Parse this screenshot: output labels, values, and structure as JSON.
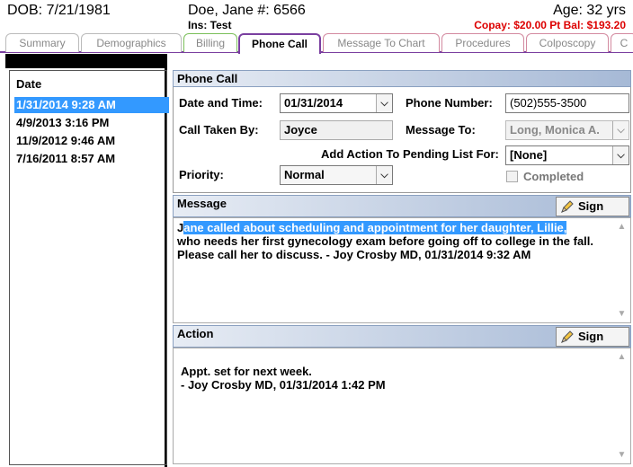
{
  "header": {
    "dob": "DOB: 7/21/1981",
    "patient": "Doe, Jane #: 6566",
    "insurance": "Ins: Test",
    "age": "Age: 32 yrs",
    "copay": "Copay: $20.00 Pt Bal: $193.20"
  },
  "tabs": [
    {
      "label": "Summary",
      "color": "#888888"
    },
    {
      "label": "Demographics",
      "color": "#888888"
    },
    {
      "label": "Billing",
      "color": "#7bbf5a"
    },
    {
      "label": "Phone Call",
      "color": "#7a3fa0"
    },
    {
      "label": "Message To Chart",
      "color": "#d38aa0"
    },
    {
      "label": "Procedures",
      "color": "#d38aa0"
    },
    {
      "label": "Colposcopy",
      "color": "#d38aa0"
    },
    {
      "label": "C",
      "color": "#d38aa0"
    }
  ],
  "left": {
    "header": "Date",
    "items": [
      "1/31/2014 9:28 AM",
      "4/9/2013 3:16 PM",
      "11/9/2012 9:46 AM",
      "7/16/2011 8:57 AM"
    ]
  },
  "phone_call": {
    "section_title": "Phone Call",
    "date_label": "Date and Time:",
    "date_value": "01/31/2014",
    "phone_label": "Phone Number:",
    "phone_value": "(502)555-3500",
    "taken_by_label": "Call Taken By:",
    "taken_by_value": "Joyce",
    "message_to_label": "Message To:",
    "message_to_value": "Long, Monica A.",
    "pending_label": "Add Action To Pending List For:",
    "pending_value": "[None]",
    "priority_label": "Priority:",
    "priority_value": "Normal",
    "completed_label": "Completed"
  },
  "message": {
    "title": "Message",
    "sign_label": "Sign",
    "first_letter": "J",
    "highlighted": "ane called about scheduling and appointment for her daughter, Lillie,",
    "rest": "who needs her first gynecology exam before going off to college in the fall. Please call her to discuss. - Joy Crosby MD, 01/31/2014 9:32 AM"
  },
  "action": {
    "title": "Action",
    "sign_label": "Sign",
    "line1": "Appt. set for next week.",
    "line2": "- Joy Crosby MD, 01/31/2014 1:42 PM"
  },
  "colors": {
    "selection": "#3399ff",
    "copay": "#dd0000",
    "active_tab": "#7a3fa0"
  }
}
